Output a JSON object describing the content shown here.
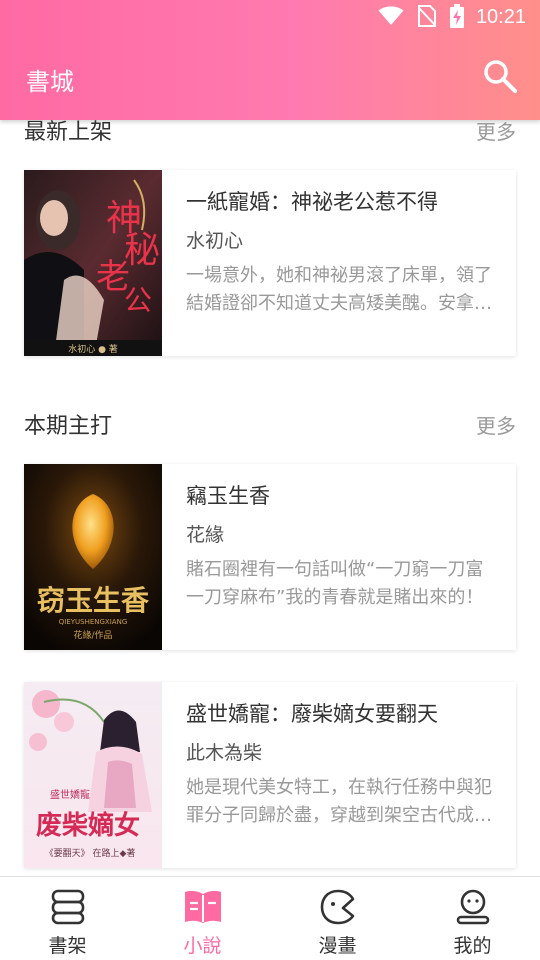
{
  "status_bar": {
    "time": "10:21",
    "icons": [
      "wifi-icon",
      "no-sim-icon",
      "battery-charging-icon"
    ]
  },
  "header": {
    "title": "書城",
    "search_icon": "search-icon"
  },
  "sections": [
    {
      "title": "最新上架",
      "more": "更多",
      "books": [
        {
          "title": "一紙寵婚：神祕老公惹不得",
          "author": "水初心",
          "description": "一場意外，她和神祕男滾了床單，領了結婚證卻不知道丈夫高矮美醜。安拿著紅本本抗議：“我要見老公。”入…",
          "cover_text": [
            "神",
            "秘",
            "老",
            "公"
          ],
          "cover_author": "水初心 ● 著"
        }
      ]
    },
    {
      "title": "本期主打",
      "more": "更多",
      "books": [
        {
          "title": "竊玉生香",
          "author": "花緣",
          "description": "賭石圈裡有一句話叫做“一刀窮一刀富一刀穿麻布”我的青春就是賭出來的！",
          "cover_text": "窃玉生香",
          "cover_sub": "QIEYUSHENGXIANG",
          "cover_author": "花緣/作品"
        },
        {
          "title": "盛世嬌寵：廢柴嫡女要翻天",
          "author": "此木為柴",
          "description": "她是現代美女特工，在執行任務中與犯罪分子同歸於盡，穿越到架空古代成了瞎眼的大將軍府嫡女。剛穿過…",
          "cover_text": "废柴嫡女",
          "cover_sub": "盛世嬌寵",
          "cover_author": "《要翻天》 在路上◆著"
        }
      ]
    }
  ],
  "bottom_nav": [
    {
      "label": "書架",
      "icon": "bookshelf-icon",
      "active": false
    },
    {
      "label": "小說",
      "icon": "open-book-icon",
      "active": true
    },
    {
      "label": "漫畫",
      "icon": "comic-bubble-icon",
      "active": false
    },
    {
      "label": "我的",
      "icon": "profile-icon",
      "active": false
    }
  ],
  "colors": {
    "accent": "#ff6aa3",
    "header_gradient_end": "#ff8f8a",
    "text_primary": "#333333",
    "text_secondary": "#999999"
  }
}
